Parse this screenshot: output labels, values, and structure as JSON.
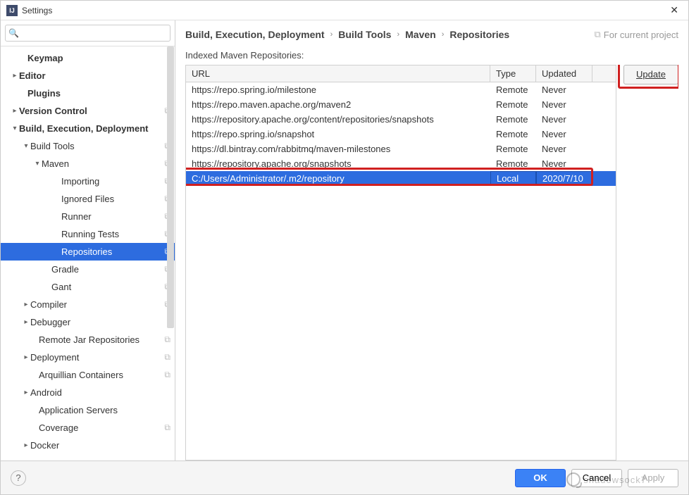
{
  "window": {
    "title": "Settings"
  },
  "search": {
    "placeholder": ""
  },
  "sidebar": {
    "items": [
      {
        "label": "Keymap",
        "indent": 26,
        "bold": true,
        "arrow": "",
        "copy": false,
        "selected": false
      },
      {
        "label": "Editor",
        "indent": 14,
        "bold": true,
        "arrow": "▸",
        "copy": false,
        "selected": false
      },
      {
        "label": "Plugins",
        "indent": 26,
        "bold": true,
        "arrow": "",
        "copy": false,
        "selected": false
      },
      {
        "label": "Version Control",
        "indent": 14,
        "bold": true,
        "arrow": "▸",
        "copy": true,
        "selected": false
      },
      {
        "label": "Build, Execution, Deployment",
        "indent": 14,
        "bold": true,
        "arrow": "▾",
        "copy": false,
        "selected": false
      },
      {
        "label": "Build Tools",
        "indent": 30,
        "bold": false,
        "arrow": "▾",
        "copy": true,
        "selected": false
      },
      {
        "label": "Maven",
        "indent": 46,
        "bold": false,
        "arrow": "▾",
        "copy": true,
        "selected": false
      },
      {
        "label": "Importing",
        "indent": 74,
        "bold": false,
        "arrow": "",
        "copy": true,
        "selected": false
      },
      {
        "label": "Ignored Files",
        "indent": 74,
        "bold": false,
        "arrow": "",
        "copy": true,
        "selected": false
      },
      {
        "label": "Runner",
        "indent": 74,
        "bold": false,
        "arrow": "",
        "copy": true,
        "selected": false
      },
      {
        "label": "Running Tests",
        "indent": 74,
        "bold": false,
        "arrow": "",
        "copy": true,
        "selected": false
      },
      {
        "label": "Repositories",
        "indent": 74,
        "bold": false,
        "arrow": "",
        "copy": true,
        "selected": true
      },
      {
        "label": "Gradle",
        "indent": 60,
        "bold": false,
        "arrow": "",
        "copy": true,
        "selected": false
      },
      {
        "label": "Gant",
        "indent": 60,
        "bold": false,
        "arrow": "",
        "copy": true,
        "selected": false
      },
      {
        "label": "Compiler",
        "indent": 30,
        "bold": false,
        "arrow": "▸",
        "copy": true,
        "selected": false
      },
      {
        "label": "Debugger",
        "indent": 30,
        "bold": false,
        "arrow": "▸",
        "copy": false,
        "selected": false
      },
      {
        "label": "Remote Jar Repositories",
        "indent": 42,
        "bold": false,
        "arrow": "",
        "copy": true,
        "selected": false
      },
      {
        "label": "Deployment",
        "indent": 30,
        "bold": false,
        "arrow": "▸",
        "copy": true,
        "selected": false
      },
      {
        "label": "Arquillian Containers",
        "indent": 42,
        "bold": false,
        "arrow": "",
        "copy": true,
        "selected": false
      },
      {
        "label": "Android",
        "indent": 30,
        "bold": false,
        "arrow": "▸",
        "copy": false,
        "selected": false
      },
      {
        "label": "Application Servers",
        "indent": 42,
        "bold": false,
        "arrow": "",
        "copy": false,
        "selected": false
      },
      {
        "label": "Coverage",
        "indent": 42,
        "bold": false,
        "arrow": "",
        "copy": true,
        "selected": false
      },
      {
        "label": "Docker",
        "indent": 30,
        "bold": false,
        "arrow": "▸",
        "copy": false,
        "selected": false
      }
    ]
  },
  "breadcrumbs": {
    "items": [
      "Build, Execution, Deployment",
      "Build Tools",
      "Maven",
      "Repositories"
    ],
    "scope": "For current project"
  },
  "section": {
    "label": "Indexed Maven Repositories:"
  },
  "table": {
    "headers": {
      "url": "URL",
      "type": "Type",
      "updated": "Updated"
    },
    "rows": [
      {
        "url": "https://repo.spring.io/milestone",
        "type": "Remote",
        "updated": "Never",
        "selected": false
      },
      {
        "url": "https://repo.maven.apache.org/maven2",
        "type": "Remote",
        "updated": "Never",
        "selected": false
      },
      {
        "url": "https://repository.apache.org/content/repositories/snapshots",
        "type": "Remote",
        "updated": "Never",
        "selected": false
      },
      {
        "url": "https://repo.spring.io/snapshot",
        "type": "Remote",
        "updated": "Never",
        "selected": false
      },
      {
        "url": "https://dl.bintray.com/rabbitmq/maven-milestones",
        "type": "Remote",
        "updated": "Never",
        "selected": false
      },
      {
        "url": "https://repository.apache.org/snapshots",
        "type": "Remote",
        "updated": "Never",
        "selected": false
      },
      {
        "url": "C:/Users/Administrator/.m2/repository",
        "type": "Local",
        "updated": "2020/7/10",
        "selected": true
      }
    ]
  },
  "buttons": {
    "update": "Update",
    "ok": "OK",
    "cancel": "Cancel",
    "apply": "Apply"
  },
  "watermark": "shadowsock7"
}
